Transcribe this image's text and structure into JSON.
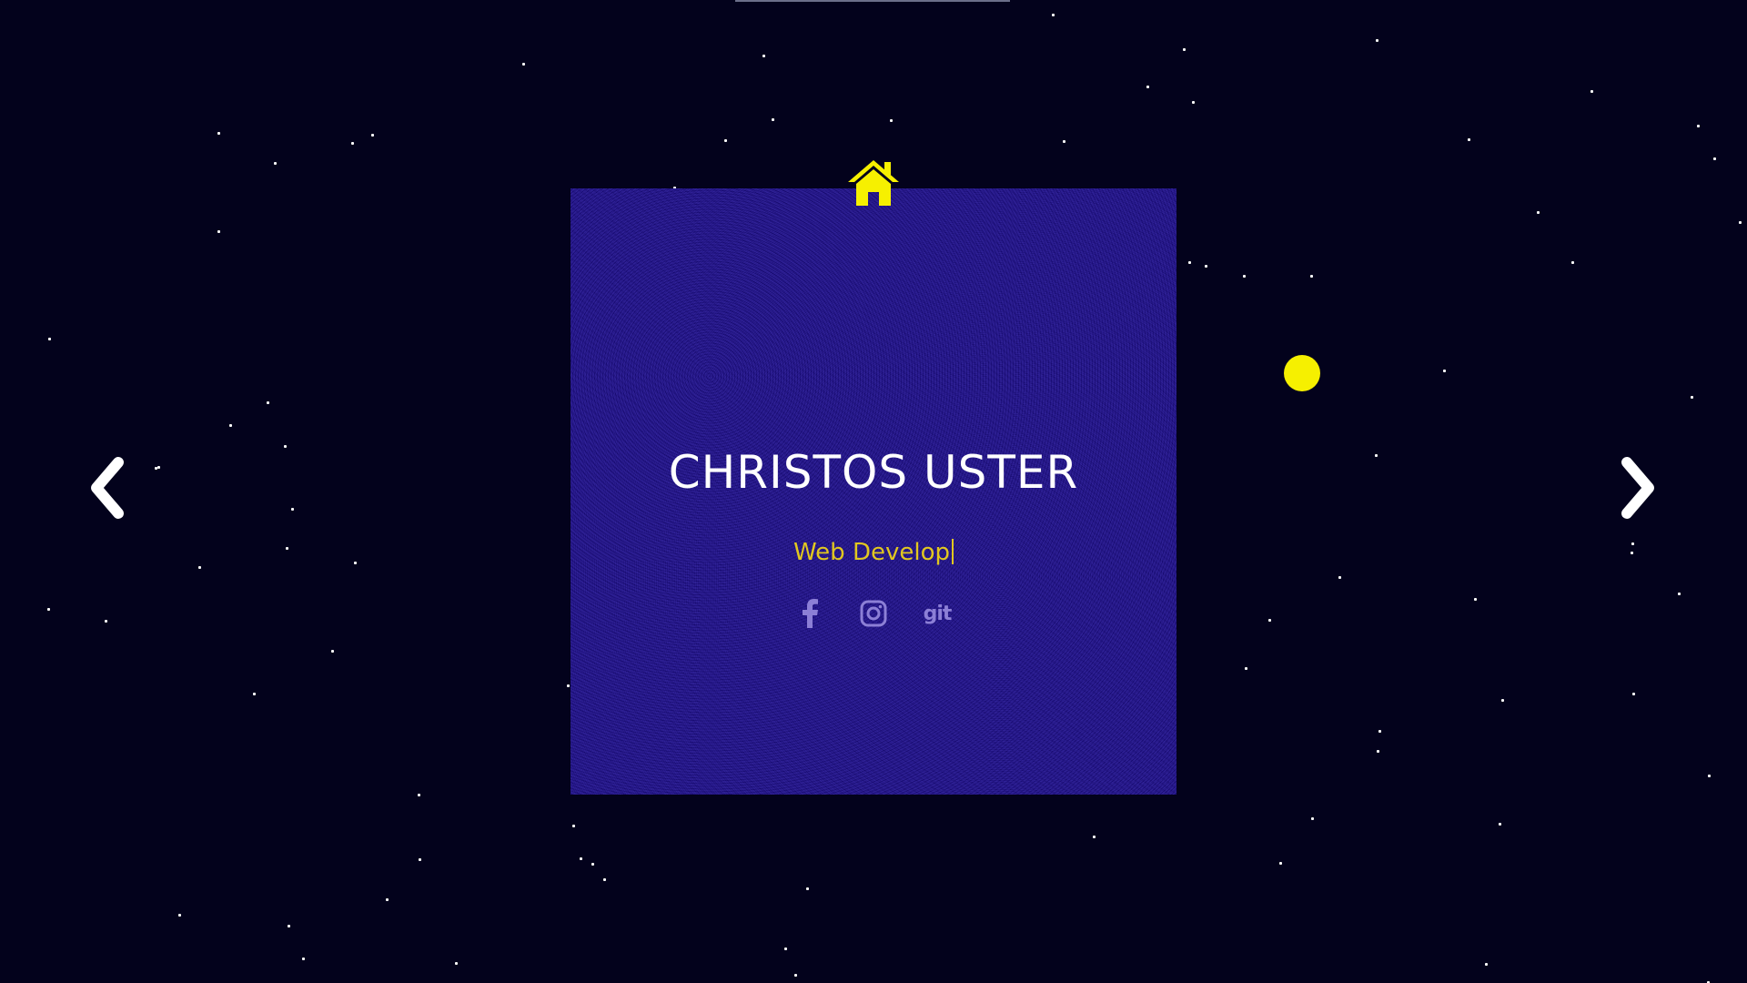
{
  "profile": {
    "name": "CHRISTOS USTER",
    "role_typed": "Web Develop"
  },
  "socials": [
    {
      "name": "facebook",
      "icon": "facebook-icon"
    },
    {
      "name": "instagram",
      "icon": "instagram-icon"
    },
    {
      "name": "git",
      "label": "git",
      "icon": "git-icon"
    }
  ],
  "nav": {
    "home_icon": "home-icon",
    "prev_icon": "chevron-left-icon",
    "next_icon": "chevron-right-icon"
  },
  "colors": {
    "background": "#03021c",
    "card": "#1d0d8f",
    "accent_yellow": "#f6f000",
    "role_text": "#e1c720",
    "social_icon": "#8c7fd6",
    "name_text": "#ffffff"
  }
}
